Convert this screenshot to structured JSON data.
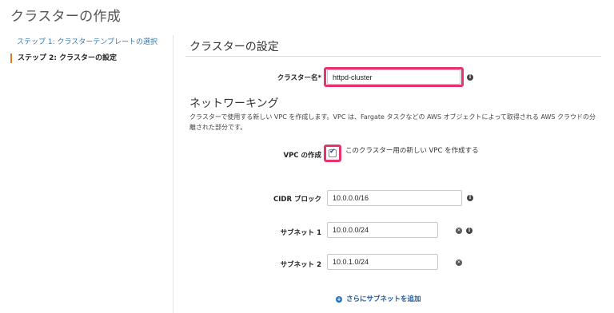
{
  "page": {
    "title": "クラスターの作成"
  },
  "nav": {
    "step1": "ステップ 1: クラスターテンプレートの選択",
    "step2": "ステップ 2: クラスターの設定"
  },
  "cluster_settings": {
    "section_title": "クラスターの設定",
    "name_label": "クラスター名*",
    "name_value": "httpd-cluster"
  },
  "networking": {
    "section_title": "ネットワーキング",
    "description": "クラスターで使用する新しい VPC を作成します。VPC は、Fargate タスクなどの AWS オブジェクトによって取得される AWS クラウドの分離された部分です。",
    "vpc_label": "VPC の作成",
    "vpc_checked": true,
    "vpc_checkbox_text": "このクラスター用の新しい VPC を作成する",
    "cidr_label": "CIDR ブロック",
    "cidr_value": "10.0.0.0/16",
    "subnet1_label": "サブネット 1",
    "subnet1_value": "10.0.0.0/24",
    "subnet2_label": "サブネット 2",
    "subnet2_value": "10.0.1.0/24",
    "add_subnet": "さらにサブネットを追加"
  },
  "colors": {
    "highlight": "#e6336f",
    "link": "#3a78a8",
    "current_step_marker": "#e07b22"
  },
  "icons": [
    "info-icon",
    "remove-icon",
    "add-icon",
    "check-icon"
  ]
}
